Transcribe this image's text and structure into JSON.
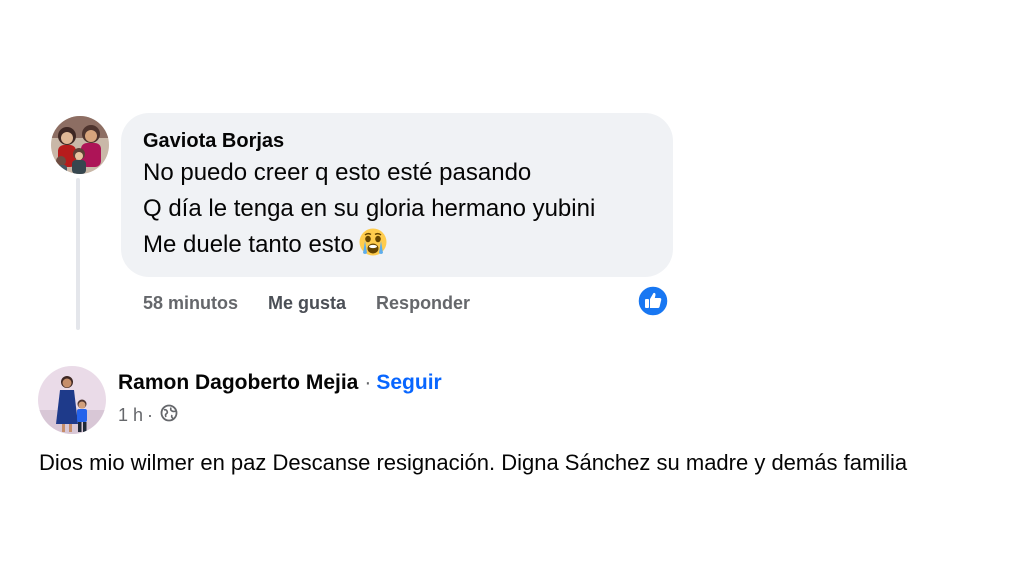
{
  "comment": {
    "author": "Gaviota Borjas",
    "lines": [
      "No puedo creer q esto esté pasando",
      "Q día le tenga en su gloria hermano yubini",
      "Me duele tanto esto"
    ],
    "emoji": "crying-face-emoji",
    "time": "58 minutos",
    "like_label": "Me gusta",
    "reply_label": "Responder",
    "reaction_icon": "like-reaction-icon",
    "bubble_color": "#f0f2f5"
  },
  "post": {
    "author": "Ramon Dagoberto Mejia",
    "separator": "·",
    "follow_label": "Seguir",
    "time": "1 h",
    "meta_separator": "·",
    "privacy_icon": "globe-icon",
    "text": "Dios mio wilmer en paz Descanse resignación. Digna Sánchez su madre y demás familia"
  },
  "colors": {
    "text": "#050505",
    "secondary_text": "#65676b",
    "link_blue": "#0866ff",
    "reaction_blue": "#1877f2"
  }
}
